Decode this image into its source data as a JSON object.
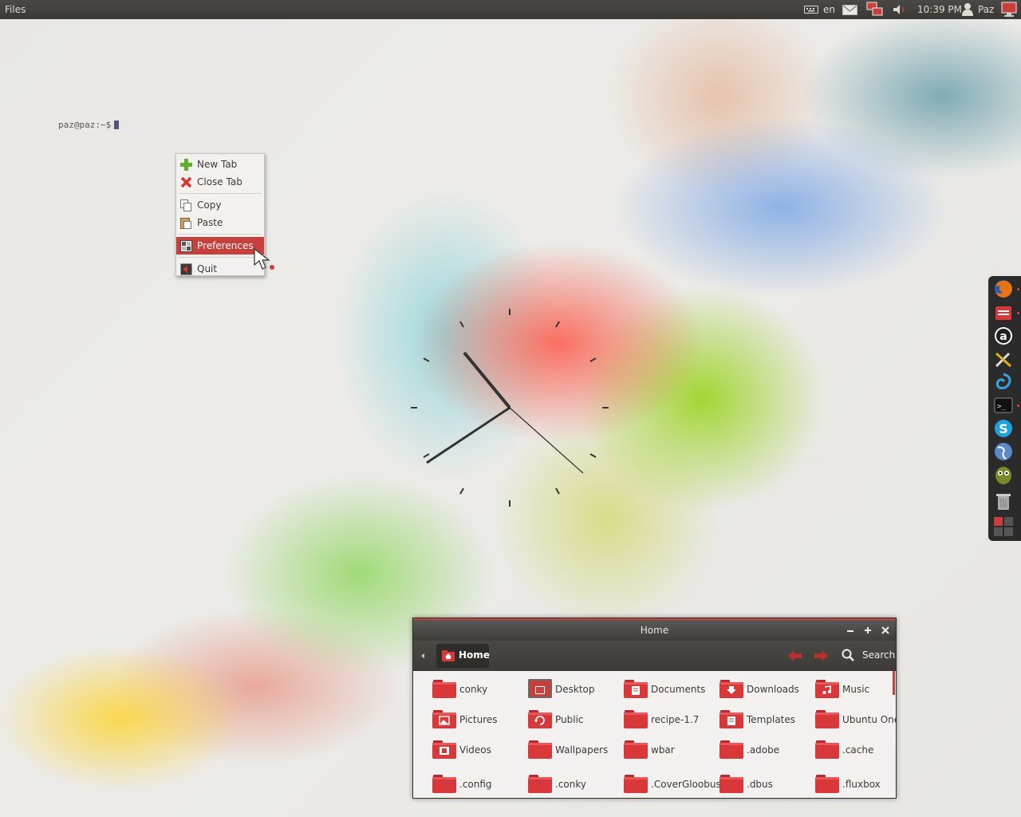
{
  "top_panel": {
    "app_name": "Files",
    "keyboard_layout": "en",
    "time": "10:39 PM",
    "user": "Paz"
  },
  "terminal": {
    "prompt": "paz@paz:~$"
  },
  "context_menu": {
    "items": [
      {
        "label": "New Tab",
        "icon": "add-icon"
      },
      {
        "label": "Close Tab",
        "icon": "close-icon"
      },
      {
        "label": "Copy",
        "icon": "copy-icon"
      },
      {
        "label": "Paste",
        "icon": "paste-icon"
      },
      {
        "label": "Preferences",
        "icon": "preferences-icon",
        "highlighted": true
      },
      {
        "label": "Quit",
        "icon": "quit-icon"
      }
    ]
  },
  "dock": {
    "items": [
      "firefox-icon",
      "file-manager-icon",
      "amazon-icon",
      "tools-icon",
      "swirl-icon",
      "terminal-icon",
      "skype-icon",
      "globe-icon",
      "owl-icon",
      "trash-icon",
      "workspaces-icon"
    ]
  },
  "file_manager": {
    "title": "Home",
    "location": "Home",
    "search_label": "Search",
    "items": [
      {
        "name": "conky",
        "emblem": ""
      },
      {
        "name": "Desktop",
        "emblem": "desktop"
      },
      {
        "name": "Documents",
        "emblem": "documents"
      },
      {
        "name": "Downloads",
        "emblem": "downloads"
      },
      {
        "name": "Music",
        "emblem": "music"
      },
      {
        "name": "Pictures",
        "emblem": "pictures"
      },
      {
        "name": "Public",
        "emblem": "public"
      },
      {
        "name": "recipe-1.7",
        "emblem": ""
      },
      {
        "name": "Templates",
        "emblem": "templates"
      },
      {
        "name": "Ubuntu One",
        "emblem": ""
      },
      {
        "name": "Videos",
        "emblem": "videos"
      },
      {
        "name": "Wallpapers",
        "emblem": ""
      },
      {
        "name": "wbar",
        "emblem": ""
      },
      {
        "name": ".adobe",
        "emblem": ""
      },
      {
        "name": ".cache",
        "emblem": ""
      },
      {
        "name": ".config",
        "emblem": ""
      },
      {
        "name": ".conky",
        "emblem": ""
      },
      {
        "name": ".CoverGloobus",
        "emblem": ""
      },
      {
        "name": ".dbus",
        "emblem": ""
      },
      {
        "name": ".fluxbox",
        "emblem": ""
      }
    ]
  },
  "colors": {
    "accent": "#c8403e",
    "panel": "#3c3b37",
    "folder": "#d9383a"
  }
}
